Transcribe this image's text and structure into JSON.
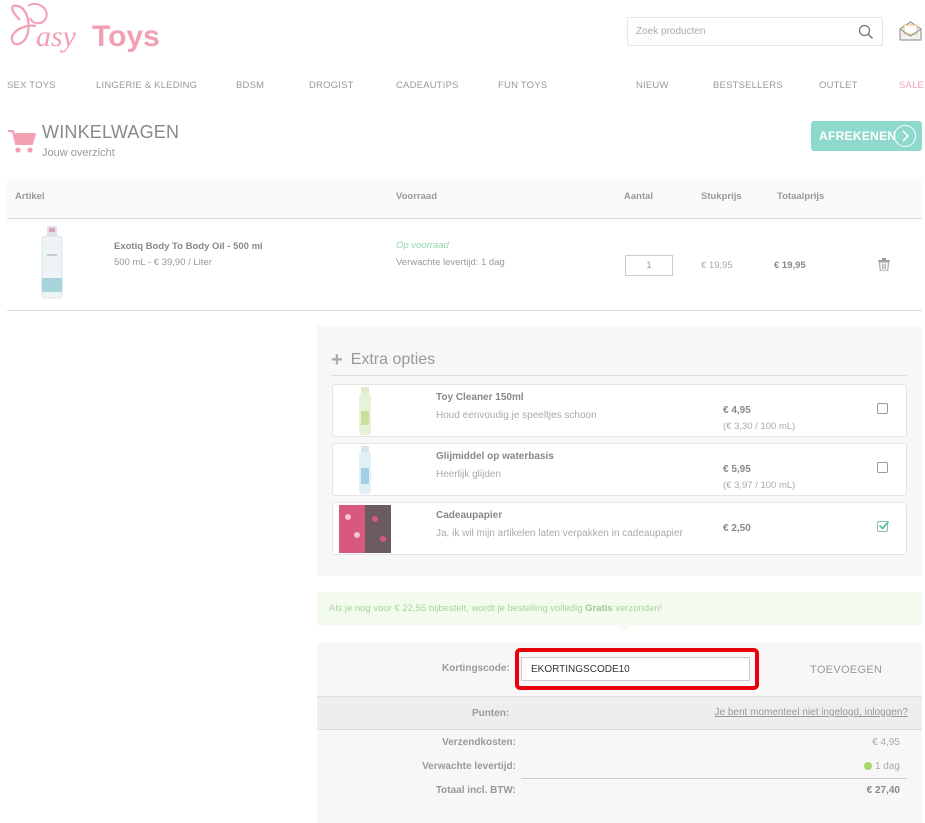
{
  "header": {
    "logo_text": "EasyToys",
    "search_placeholder": "Zoek producten"
  },
  "nav": [
    "SEX TOYS",
    "LINGERIE & KLEDING",
    "BDSM",
    "DROGIST",
    "CADEAUTIPS",
    "FUN TOYS",
    "NIEUW",
    "BESTSELLERS",
    "OUTLET",
    "SALE"
  ],
  "colors": {
    "brand_pink": "#f4a0b4",
    "accent_teal": "#8fd8cd",
    "sale": "#f4a0b4",
    "highlight": "#e8000b",
    "in_stock": "#8fd8b0"
  },
  "page": {
    "title": "WINKELWAGEN",
    "subtitle": "Jouw overzicht",
    "checkout_label": "AFREKENEN"
  },
  "table": {
    "headers": {
      "article": "Artikel",
      "stock": "Voorraad",
      "qty": "Aantal",
      "unit": "Stukprijs",
      "total": "Totaalprijs"
    },
    "items": [
      {
        "name": "Exotiq Body To Body Oil - 500 ml",
        "sub": "500 mL - € 39,90 / Liter",
        "stock": "Op voorraad",
        "delivery": "Verwachte levertijd: 1 dag",
        "qty": "1",
        "unit_price": "€ 19,95",
        "total_price": "€ 19,95"
      }
    ]
  },
  "extras": {
    "heading": "Extra opties",
    "options": [
      {
        "name": "Toy Cleaner 150ml",
        "desc": "Houd eenvoudig je speeltjes schoon",
        "price": "€ 4,95",
        "unit": "(€ 3,30 / 100 mL)",
        "checked": false
      },
      {
        "name": "Glijmiddel op waterbasis",
        "desc": "Heerlijk glijden",
        "price": "€ 5,95",
        "unit": "(€ 3,97 / 100 mL)",
        "checked": false
      },
      {
        "name": "Cadeaupapier",
        "desc": "Ja, ik wil mijn artikelen laten verpakken in cadeaupapier",
        "price": "€ 2,50",
        "unit": "",
        "checked": true
      }
    ]
  },
  "notice": {
    "pre": "Als je nog voor € 22,55 bijbestelt, wordt je bestelling volledig ",
    "bold": "Gratis",
    "post": " verzonden!"
  },
  "coupon": {
    "label": "Kortingscode:",
    "value": "EKORTINGSCODE10",
    "add_label": "TOEVOEGEN"
  },
  "totals": {
    "points_label": "Punten:",
    "points_link": "Je bent momenteel niet ingelogd, inloggen?",
    "shipping_label": "Verzendkosten:",
    "shipping_value": "€ 4,95",
    "delivery_label": "Verwachte levertijd:",
    "delivery_value": "1 dag",
    "total_label": "Totaal incl. BTW:",
    "total_value": "€ 27,40"
  }
}
